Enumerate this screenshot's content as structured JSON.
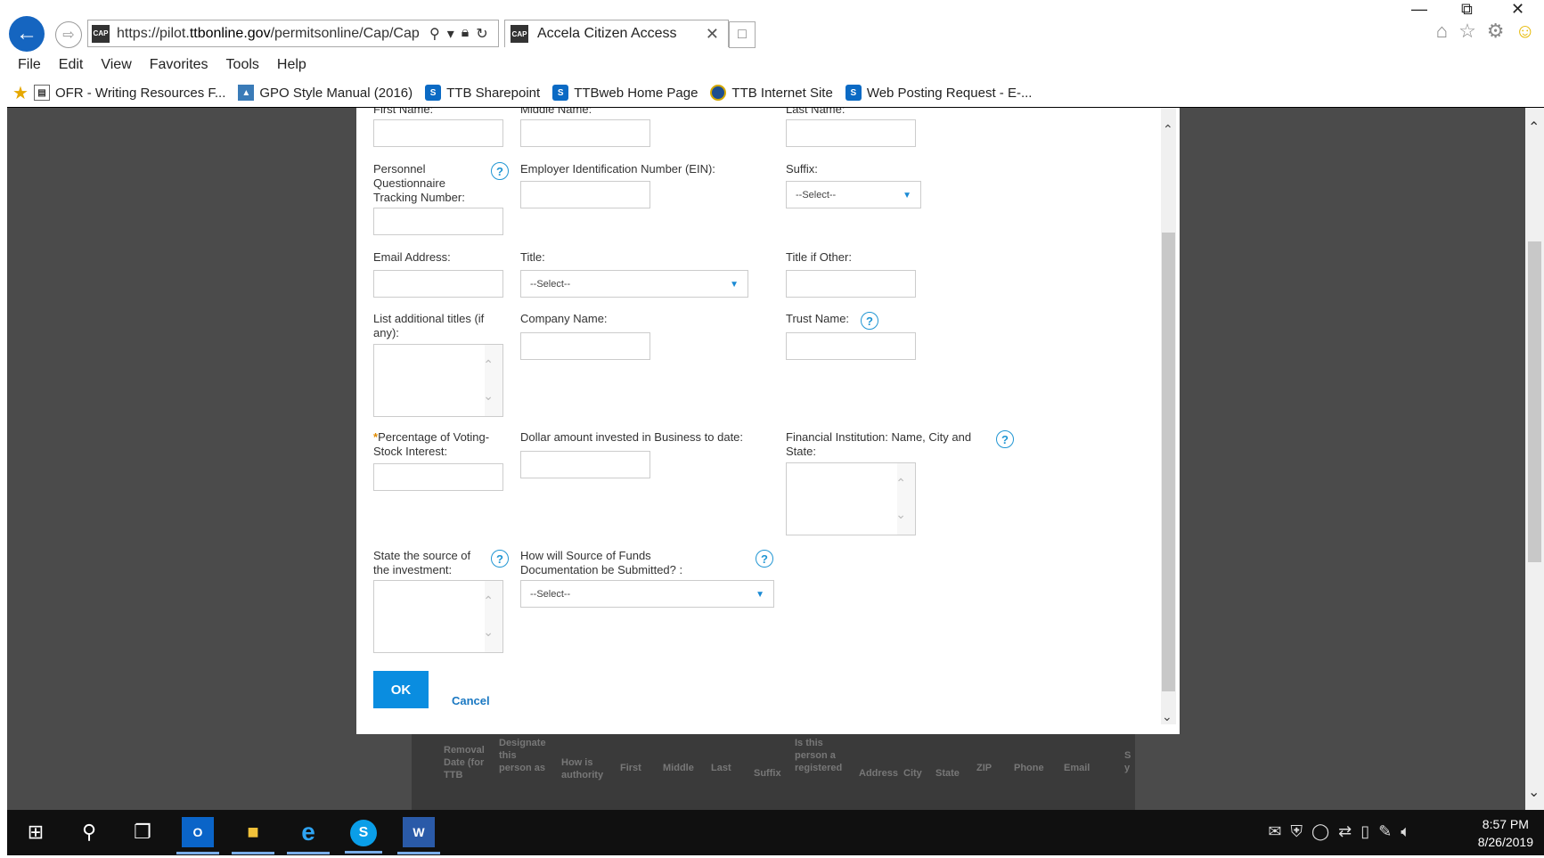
{
  "browser": {
    "url_prefix": "https://pilot.",
    "url_domain": "ttbonline.gov",
    "url_suffix": "/permitsonline/Cap/Cap",
    "tab_title": "Accela Citizen Access",
    "favicon_text": "CAP"
  },
  "menu": [
    "File",
    "Edit",
    "View",
    "Favorites",
    "Tools",
    "Help"
  ],
  "favorites": [
    {
      "label": "OFR - Writing Resources F...",
      "icon": "document-icon"
    },
    {
      "label": "GPO Style Manual (2016)",
      "icon": "gpo-icon"
    },
    {
      "label": "TTB Sharepoint",
      "icon": "sharepoint-icon"
    },
    {
      "label": "TTBweb Home Page",
      "icon": "sharepoint-icon"
    },
    {
      "label": "TTB Internet Site",
      "icon": "seal-icon"
    },
    {
      "label": "Web Posting Request - E-...",
      "icon": "sharepoint-icon"
    }
  ],
  "form": {
    "first_name_label": "First Name:",
    "middle_name_label": "Middle Name:",
    "last_name_label": "Last Name:",
    "pq_tracking_label": "Personnel Questionnaire Tracking Number:",
    "ein_label": "Employer Identification Number (EIN):",
    "suffix_label": "Suffix:",
    "suffix_value": "--Select--",
    "email_label": "Email Address:",
    "title_label": "Title:",
    "title_value": "--Select--",
    "title_other_label": "Title if Other:",
    "additional_titles_label": "List additional titles (if any):",
    "company_label": "Company Name:",
    "trust_label": "Trust Name:",
    "req_marker": "*",
    "voting_label": "Percentage of Voting-Stock Interest:",
    "dollar_label": "Dollar amount invested in Business to date:",
    "fin_inst_label": "Financial Institution: Name, City and State:",
    "source_label": "State the source of the investment:",
    "source_doc_label": "How will Source of Funds Documentation be Submitted? :",
    "source_doc_value": "--Select--",
    "help_glyph": "?",
    "ok_label": "OK",
    "cancel_label": "Cancel"
  },
  "bg_table_headers": [
    "Removal Date (for TTB",
    "Designate this person as",
    "How is authority",
    "First",
    "Middle",
    "Last",
    "Suffix",
    "Is this person a registered",
    "Address",
    "City",
    "State",
    "ZIP",
    "Phone",
    "Email",
    "S y"
  ],
  "taskbar": {
    "time": "8:57 PM",
    "date": "8/26/2019"
  },
  "colors": {
    "accent": "#0a8de0",
    "help": "#2196d3",
    "required": "#e08a00"
  }
}
